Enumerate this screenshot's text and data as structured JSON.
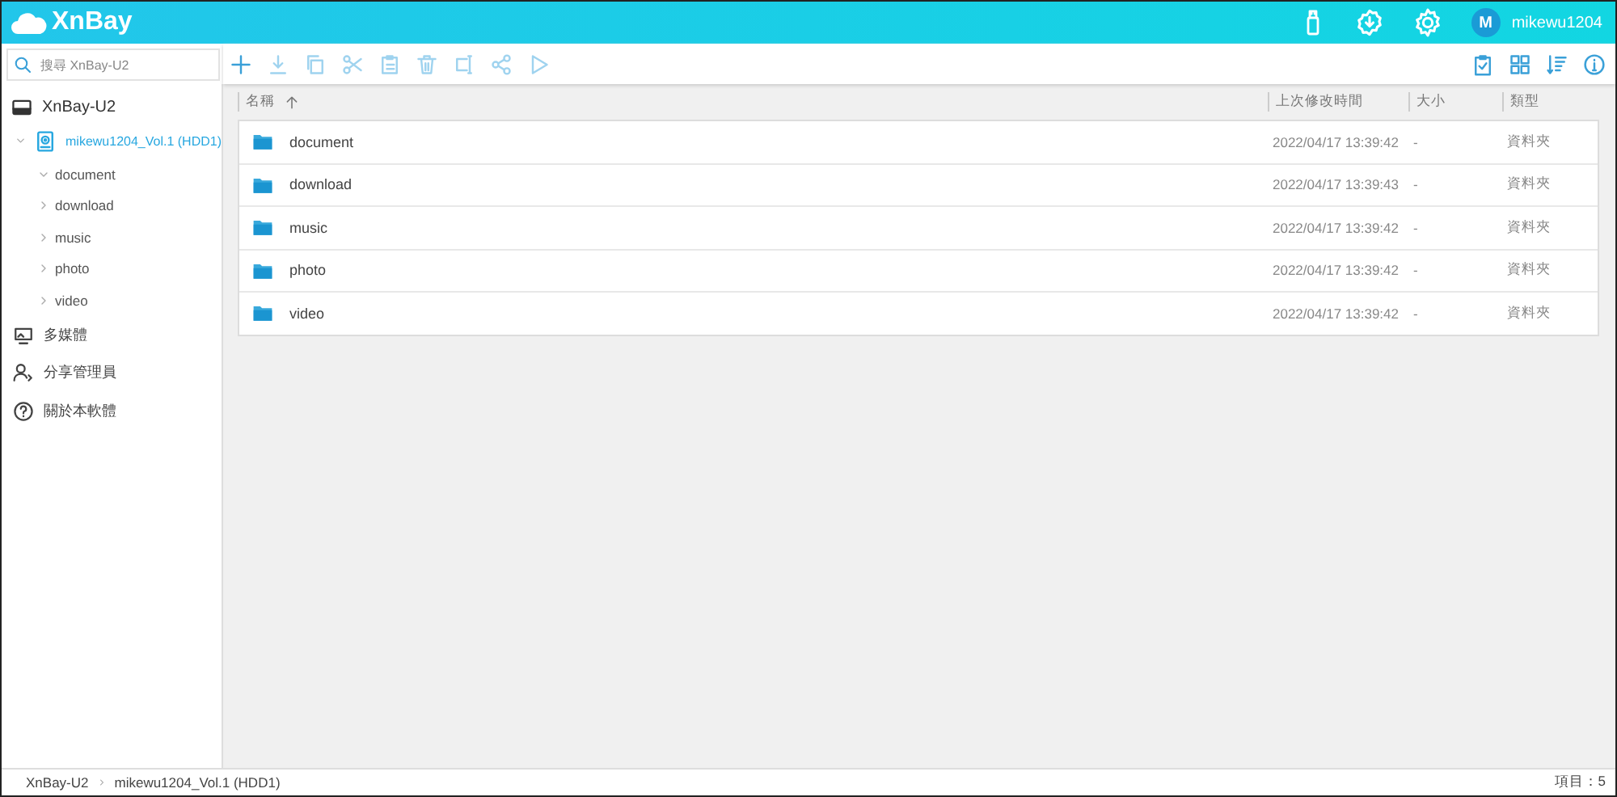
{
  "header": {
    "logo": "XnBay",
    "user": {
      "avatar": "M",
      "name": "mikewu1204"
    }
  },
  "search": {
    "placeholder": "搜尋 XnBay-U2"
  },
  "toolbar": [
    {
      "kind": "add",
      "disabled": false
    },
    {
      "kind": "download",
      "disabled": true
    },
    {
      "kind": "copy",
      "disabled": true
    },
    {
      "kind": "cut",
      "disabled": true
    },
    {
      "kind": "paste",
      "disabled": true
    },
    {
      "kind": "delete",
      "disabled": true
    },
    {
      "kind": "rename",
      "disabled": true
    },
    {
      "kind": "share",
      "disabled": true
    },
    {
      "kind": "play",
      "disabled": true
    }
  ],
  "view_tools": [
    {
      "kind": "select"
    },
    {
      "kind": "grid"
    },
    {
      "kind": "sort"
    },
    {
      "kind": "info"
    }
  ],
  "sidebar": {
    "device": "XnBay-U2",
    "tree": [
      {
        "label": "mikewu1204_Vol.1 (HDD1)",
        "selected": true,
        "expanded": true,
        "children": [
          {
            "label": "document",
            "selected": false,
            "expanded": true
          },
          {
            "label": "download",
            "selected": false,
            "expanded": false
          },
          {
            "label": "music",
            "selected": false,
            "expanded": false
          },
          {
            "label": "photo",
            "selected": false,
            "expanded": false
          },
          {
            "label": "video",
            "selected": false,
            "expanded": false
          }
        ]
      }
    ],
    "items": [
      {
        "kind": "media",
        "label": "多媒體"
      },
      {
        "kind": "share",
        "label": "分享管理員"
      },
      {
        "kind": "about",
        "label": "關於本軟體"
      }
    ]
  },
  "table": {
    "columns": [
      {
        "label": "名稱",
        "sorted": true
      },
      {
        "label": "上次修改時間",
        "sorted": false
      },
      {
        "label": "大小",
        "sorted": false
      },
      {
        "label": "類型",
        "sorted": false
      }
    ],
    "rows": [
      {
        "name": "document",
        "modified": "2022/04/17 13:39:42",
        "size": "-",
        "type": "資料夾"
      },
      {
        "name": "download",
        "modified": "2022/04/17 13:39:43",
        "size": "-",
        "type": "資料夾"
      },
      {
        "name": "music",
        "modified": "2022/04/17 13:39:42",
        "size": "-",
        "type": "資料夾"
      },
      {
        "name": "photo",
        "modified": "2022/04/17 13:39:42",
        "size": "-",
        "type": "資料夾"
      },
      {
        "name": "video",
        "modified": "2022/04/17 13:39:42",
        "size": "-",
        "type": "資料夾"
      }
    ]
  },
  "status_bar": {
    "breadcrumb": [
      "XnBay-U2",
      "mikewu1204_Vol.1 (HDD1)"
    ],
    "count": "項目：5"
  }
}
